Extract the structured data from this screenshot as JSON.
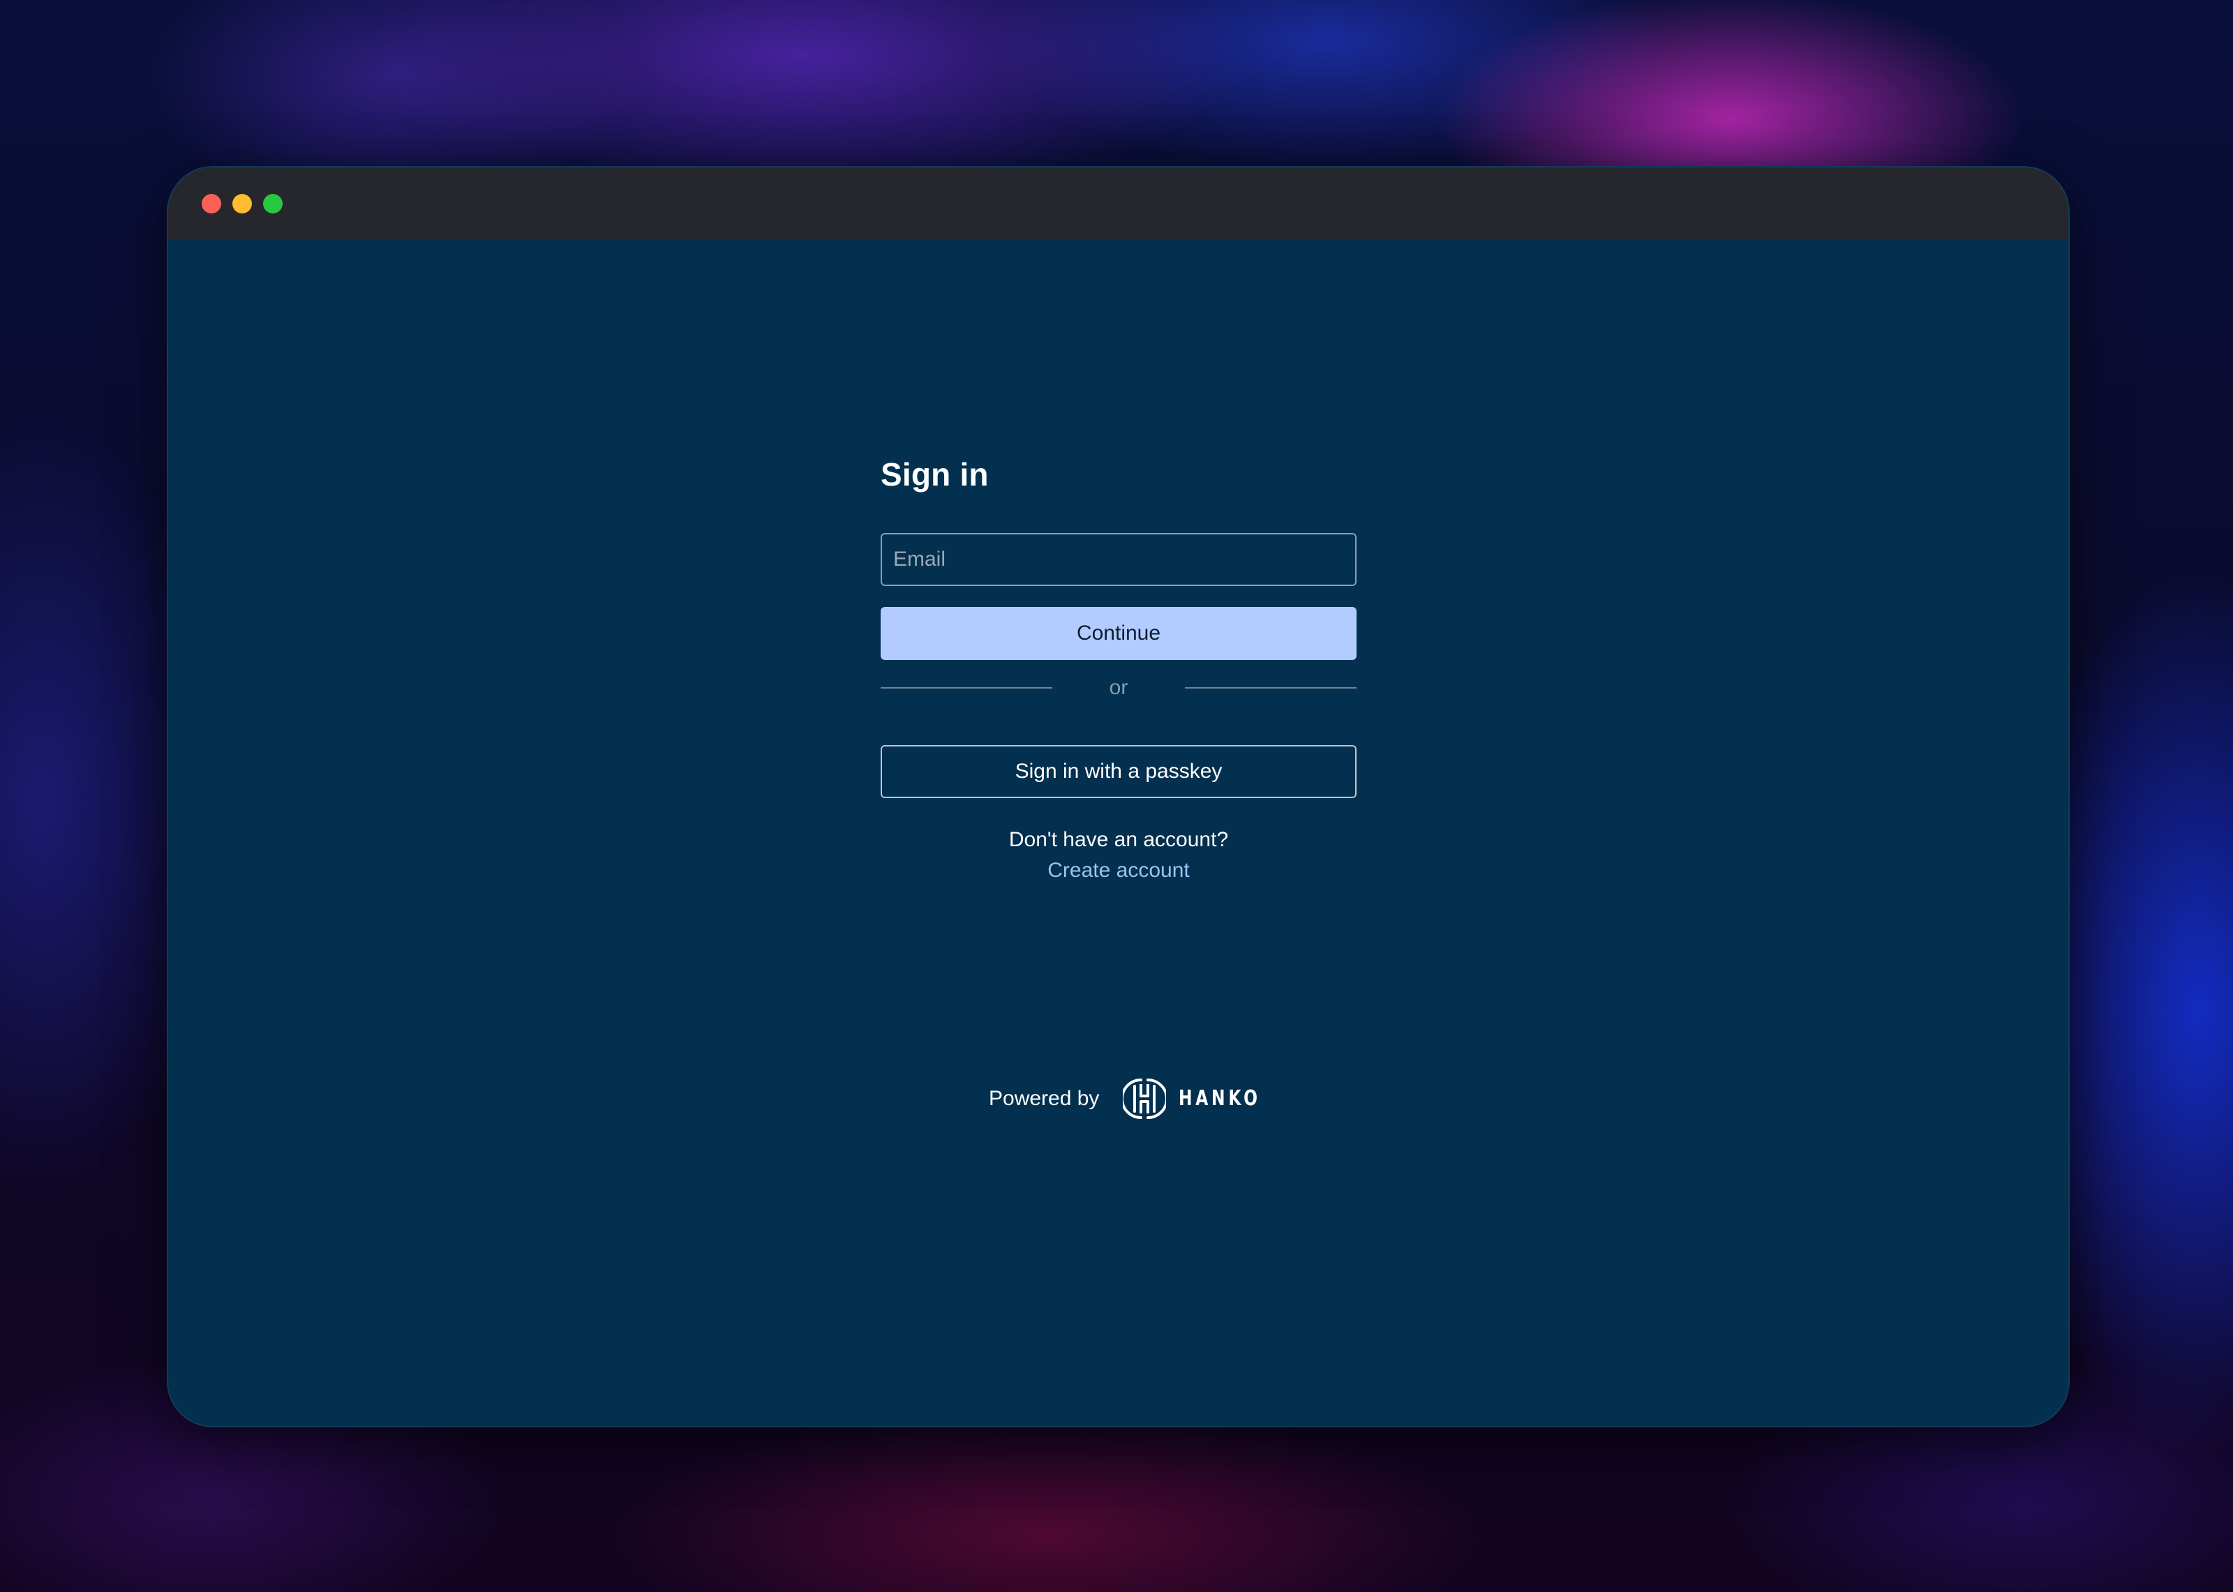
{
  "window": {
    "controls": [
      "close",
      "minimize",
      "maximize"
    ]
  },
  "signin": {
    "title": "Sign in",
    "email_placeholder": "Email",
    "email_value": "",
    "continue_label": "Continue",
    "divider_text": "or",
    "passkey_label": "Sign in with a passkey",
    "no_account_text": "Don't have an account?",
    "create_account_label": "Create account"
  },
  "footer": {
    "powered_by": "Powered by",
    "brand": "HANKO",
    "brand_icon": "hanko-logo-icon"
  },
  "colors": {
    "page_background": "#03304e",
    "titlebar": "#26272c",
    "primary_button": "#b3ccff",
    "link": "#9fc2f2",
    "close": "#fe5f57",
    "minimize": "#febc2e",
    "maximize": "#28c840"
  }
}
